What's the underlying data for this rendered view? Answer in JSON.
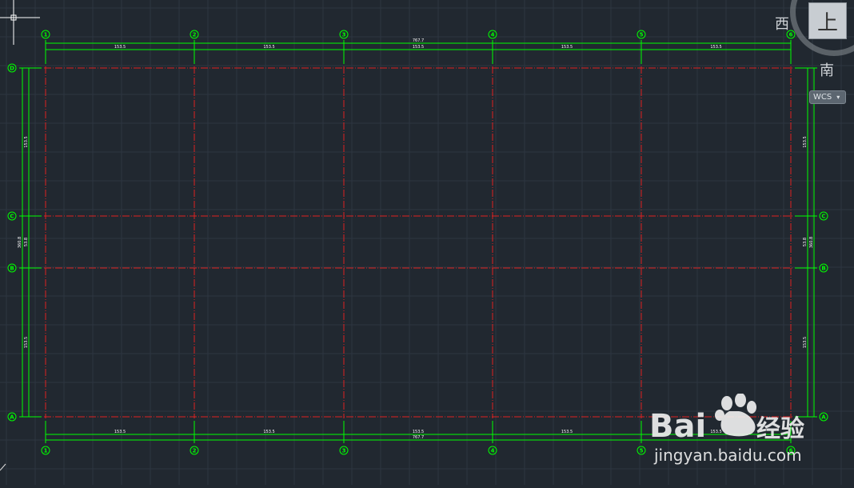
{
  "colors": {
    "background": "#212830",
    "grid": "#2d3641",
    "axis_line": "#e02020",
    "dimension": "#00ff00"
  },
  "viewcube": {
    "top_label": "上",
    "west_label": "西",
    "south_label": "南",
    "wcs_label": "WCS"
  },
  "top_axes": [
    "1",
    "2",
    "3",
    "4",
    "5",
    "6"
  ],
  "bottom_axes": [
    "1",
    "2",
    "3",
    "4",
    "5",
    "6"
  ],
  "left_axes": [
    "D",
    "C",
    "B",
    "A"
  ],
  "right_axes": [
    "C",
    "B",
    "A"
  ],
  "dims": {
    "top_total": "767.7",
    "top_spans": [
      "153.5",
      "153.5",
      "153.5",
      "153.5",
      "153.5"
    ],
    "bottom_total": "767.7",
    "bottom_spans": [
      "153.5",
      "153.5",
      "153.5",
      "153.5",
      "153.5"
    ],
    "left_spans": [
      "153.5",
      "53.8",
      "153.5"
    ],
    "left_total": "360.8",
    "right_spans": [
      "153.5",
      "53.8",
      "153.5"
    ],
    "right_total": "360.8"
  },
  "watermark": {
    "brand": "Bai",
    "brand2": "经验",
    "url": "jingyan.baidu.com"
  }
}
